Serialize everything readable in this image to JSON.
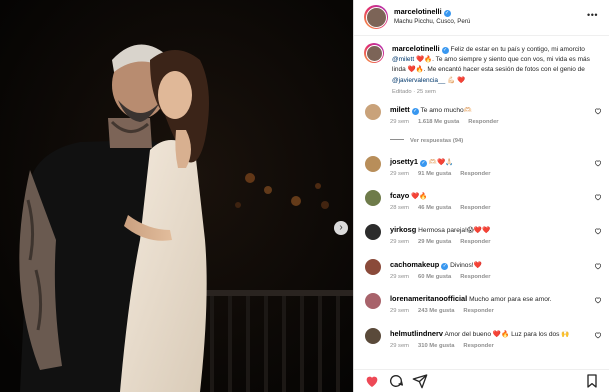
{
  "post": {
    "username": "marcelotinelli",
    "location": "Machu Picchu, Cusco, Perú"
  },
  "caption": {
    "user": "marcelotinelli",
    "text_1": "Feliz de estar en tu país y contigo, mi amorcito",
    "mention_1": "@milett",
    "text_2": ". Te amo siempre y siento que con vos, mi vida es más linda",
    "text_3": ". Me encantó hacer esta sesión de fotos con el genio de",
    "mention_2": "@javiervalencia__",
    "edited": "Editado · 25 sem"
  },
  "comments": [
    {
      "user": "milett",
      "verified": true,
      "text": "Te amo mucho🫶🏻",
      "time": "29 sem",
      "likes": "1.618 Me gusta",
      "reply": "Responder",
      "replies": "Ver respuestas (94)",
      "avatar": "#c9a27a"
    },
    {
      "user": "josetty1",
      "verified": true,
      "text": "🫶🏻❤️🙏🏻",
      "time": "29 sem",
      "likes": "91 Me gusta",
      "reply": "Responder",
      "replies": "",
      "avatar": "#b88e5a"
    },
    {
      "user": "fcayo",
      "verified": false,
      "text": "❤️🔥",
      "time": "28 sem",
      "likes": "46 Me gusta",
      "reply": "Responder",
      "replies": "",
      "avatar": "#6e7b4a"
    },
    {
      "user": "yirkosg",
      "verified": false,
      "text": "Hermosa pareja!😱❤️❤️",
      "time": "29 sem",
      "likes": "29 Me gusta",
      "reply": "Responder",
      "replies": "",
      "avatar": "#2c2c2c"
    },
    {
      "user": "cachomakeup",
      "verified": true,
      "text": "Divinos!❤️",
      "time": "29 sem",
      "likes": "60 Me gusta",
      "reply": "Responder",
      "replies": "",
      "avatar": "#8a4a3a"
    },
    {
      "user": "lorenameritanoofficial",
      "verified": false,
      "text": "Mucho amor para ese amor.",
      "time": "29 sem",
      "likes": "243 Me gusta",
      "reply": "Responder",
      "replies": "",
      "avatar": "#a8636b"
    },
    {
      "user": "helmutlindnerv",
      "verified": false,
      "text": "Amor del bueno ❤️🔥 Luz para los dos 🙌",
      "time": "29 sem",
      "likes": "310 Me gusta",
      "reply": "Responder",
      "replies": "",
      "avatar": "#5a4a3a"
    }
  ],
  "actions": [
    "like-icon",
    "comment-icon",
    "share-icon",
    "save-icon"
  ],
  "colors": {
    "accent": "#3897f0",
    "like": "#ed4956",
    "mention": "#00376b",
    "muted": "#8e8e8e"
  }
}
